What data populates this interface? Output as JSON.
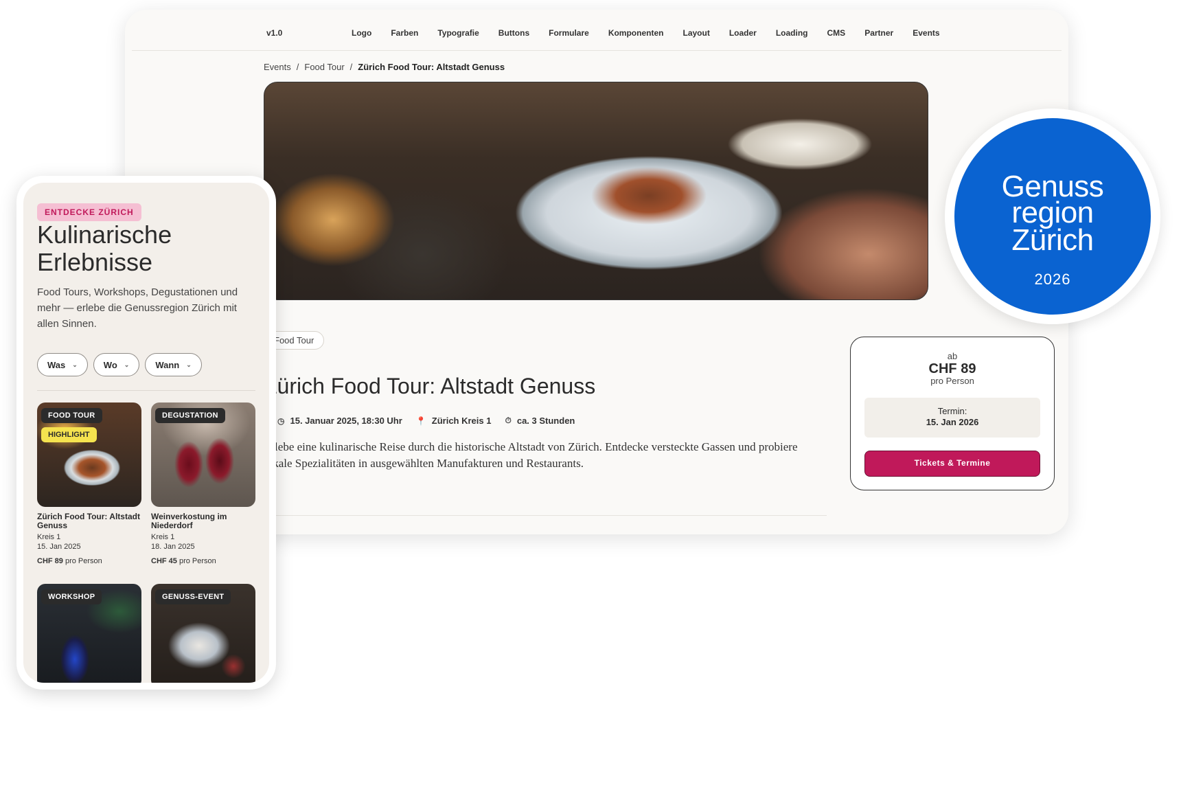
{
  "desktop": {
    "version": "v1.0",
    "nav": [
      "Logo",
      "Farben",
      "Typografie",
      "Buttons",
      "Formulare",
      "Komponenten",
      "Layout",
      "Loader",
      "Loading",
      "CMS",
      "Partner",
      "Events"
    ],
    "breadcrumb": {
      "items": [
        "Events",
        "Food Tour"
      ],
      "current": "Zürich Food Tour: Altstadt Genuss",
      "separator": "/"
    },
    "tag": "Food Tour",
    "title": "Zürich Food Tour: Altstadt Genuss",
    "meta": {
      "date": "15. Januar 2025, 18:30 Uhr",
      "location": "Zürich Kreis 1",
      "duration": "ca. 3 Stunden"
    },
    "description": "Erlebe eine kulinarische Reise durch die historische Altstadt von Zürich. Entdecke versteckte Gassen und probiere lokale Spezialitäten in ausgewählten Manufakturen und Restaurants.",
    "price_card": {
      "prefix": "ab",
      "price": "CHF 89",
      "per": "pro Person",
      "termin_label": "Termin:",
      "termin_value": "15. Jan 2026",
      "button": "Tickets & Termine"
    }
  },
  "badge": {
    "line1": "Genuss",
    "line2": "region",
    "line3": "Zürich",
    "year": "2026"
  },
  "mobile": {
    "kicker": "ENTDECKE ZÜRICH",
    "title_line1": "Kulinarische",
    "title_line2": "Erlebnisse",
    "description": "Food Tours, Workshops, Degustationen und mehr — erlebe die Genussregion Zürich mit allen Sinnen.",
    "filters": [
      "Was",
      "Wo",
      "Wann"
    ],
    "cards": [
      {
        "category": "FOOD TOUR",
        "highlight": "HIGHLIGHT",
        "title": "Zürich Food Tour: Altstadt Genuss",
        "location": "Kreis 1",
        "date": "15. Jan 2025",
        "price": "CHF 89",
        "per": "pro Person"
      },
      {
        "category": "DEGUSTATION",
        "title": "Weinverkostung im Niederdorf",
        "location": "Kreis 1",
        "date": "18. Jan 2025",
        "price": "CHF 45",
        "per": "pro Person"
      },
      {
        "category": "WORKSHOP"
      },
      {
        "category": "GENUSS-EVENT"
      }
    ]
  },
  "colors": {
    "accent": "#c0195a",
    "badge_blue": "#0a63d1",
    "highlight_yellow": "#f5e34f"
  },
  "icons": {
    "date": "clock-icon",
    "location": "pin-icon",
    "duration": "timer-icon"
  }
}
